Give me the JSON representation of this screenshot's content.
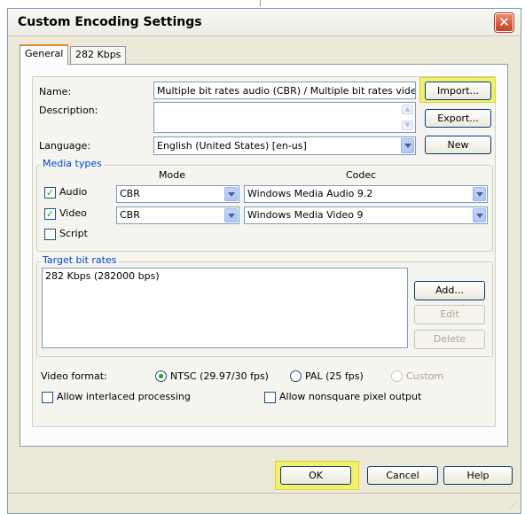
{
  "window": {
    "title": "Custom Encoding Settings"
  },
  "tabs": [
    {
      "label": "General"
    },
    {
      "label": "282 Kbps"
    }
  ],
  "general": {
    "name_label": "Name:",
    "name_value": "Multiple bit rates audio (CBR) / Multiple bit rates video (C",
    "description_label": "Description:",
    "description_value": "",
    "language_label": "Language:",
    "language_value": "English (United States) [en-us]",
    "import_label": "Import...",
    "export_label": "Export...",
    "new_label": "New"
  },
  "media_types": {
    "title": "Media types",
    "mode_header": "Mode",
    "codec_header": "Codec",
    "rows": [
      {
        "label": "Audio",
        "checked": true,
        "mode": "CBR",
        "codec": "Windows Media Audio 9.2"
      },
      {
        "label": "Video",
        "checked": true,
        "mode": "CBR",
        "codec": "Windows Media Video 9"
      },
      {
        "label": "Script",
        "checked": false
      }
    ]
  },
  "target_bit_rates": {
    "title": "Target bit rates",
    "items": [
      "282 Kbps (282000 bps)"
    ],
    "add_label": "Add...",
    "edit_label": "Edit",
    "delete_label": "Delete"
  },
  "video_format": {
    "label": "Video format:",
    "options": [
      {
        "label": "NTSC (29.97/30 fps)",
        "selected": true,
        "enabled": true
      },
      {
        "label": "PAL (25 fps)",
        "selected": false,
        "enabled": true
      },
      {
        "label": "Custom",
        "selected": false,
        "enabled": false
      }
    ],
    "interlaced_label": "Allow interlaced processing",
    "nonsquare_label": "Allow nonsquare pixel output"
  },
  "footer": {
    "ok_label": "OK",
    "cancel_label": "Cancel",
    "help_label": "Help"
  },
  "colors": {
    "highlight": "#f3f06b",
    "group_title": "#0046d5",
    "check": "#21a121"
  }
}
